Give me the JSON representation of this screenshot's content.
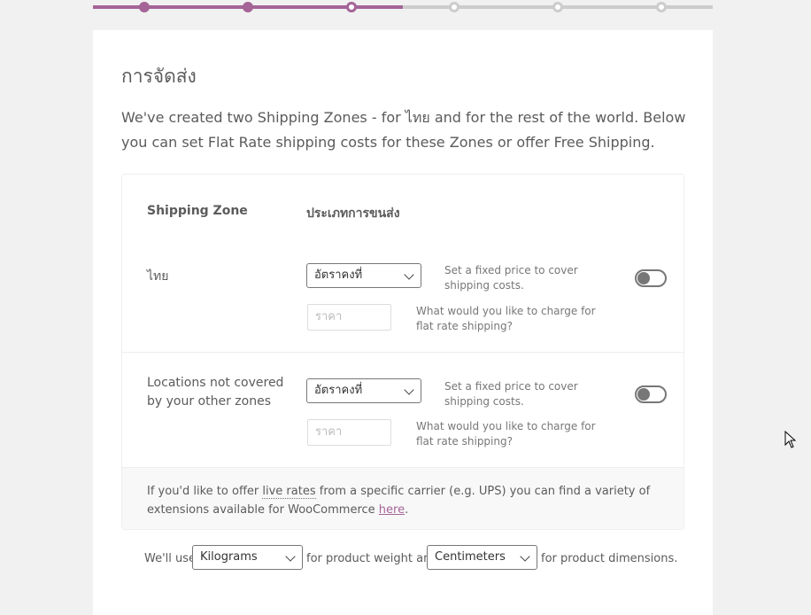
{
  "progress": {
    "steps": 6,
    "current_step": 3
  },
  "heading": "การจัดส่ง",
  "intro": "We've created two Shipping Zones - for ไทย and for the rest of the world. Below you can set Flat Rate shipping costs for these Zones or offer Free Shipping.",
  "table": {
    "col_zone": "Shipping Zone",
    "col_method": "ประเภทการขนส่ง",
    "rows": [
      {
        "zone": "ไทย",
        "method": "อัตราคงที่",
        "method_desc": "Set a fixed price to cover shipping costs.",
        "price_placeholder": "ราคา",
        "price_desc": "What would you like to charge for flat rate shipping?",
        "enabled": false
      },
      {
        "zone": "Locations not covered by your other zones",
        "method": "อัตราคงที่",
        "method_desc": "Set a fixed price to cover shipping costs.",
        "price_placeholder": "ราคา",
        "price_desc": "What would you like to charge for flat rate shipping?",
        "enabled": false
      }
    ]
  },
  "note": {
    "before": "If you'd like to offer ",
    "abbr": "live rates",
    "middle": " from a specific carrier (e.g. UPS) you can find a variety of extensions available for WooCommerce ",
    "link": "here",
    "after": "."
  },
  "units": {
    "prefix": "We'll use",
    "weight": "Kilograms",
    "middle": "for product weight and",
    "dimension": "Centimeters",
    "suffix": "for product dimensions."
  },
  "colors": {
    "accent": "#a46497",
    "track": "#cccccc"
  }
}
